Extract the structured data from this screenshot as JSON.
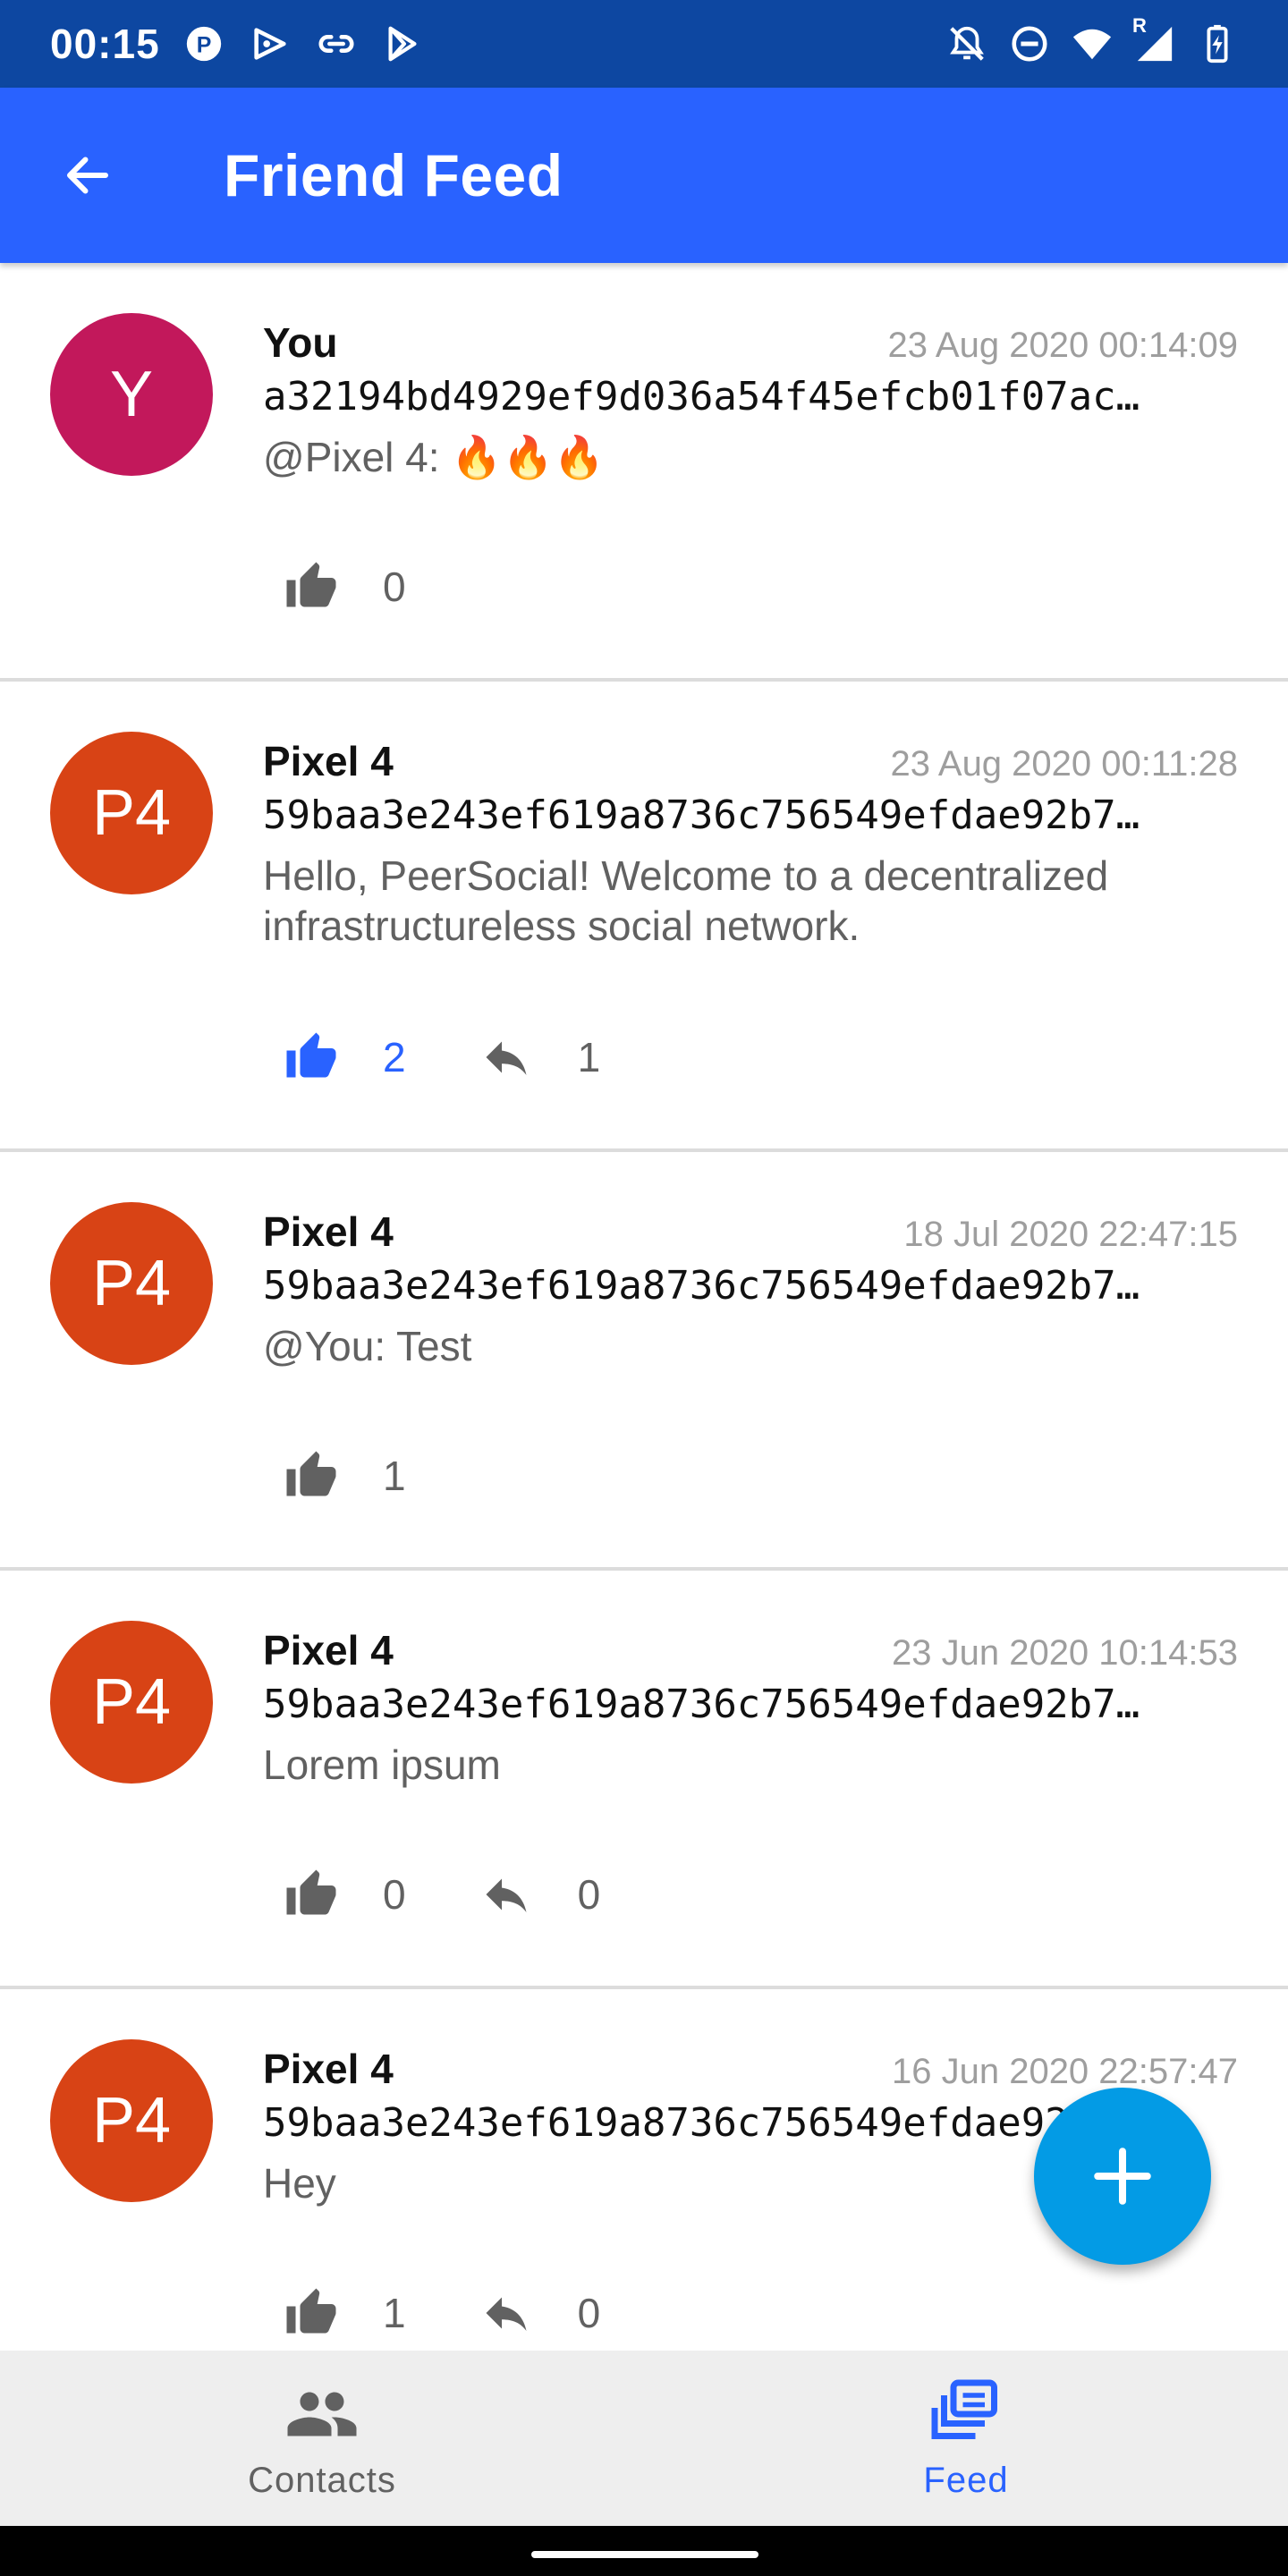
{
  "status_bar": {
    "time": "00:15",
    "left_icons": [
      "app-p-icon",
      "play-games-icon",
      "link-icon",
      "play-store-icon"
    ],
    "right_icons": [
      "mute-icon",
      "dnd-icon",
      "wifi-icon",
      "cell-signal-icon",
      "battery-charging-icon"
    ],
    "roaming_indicator": "R"
  },
  "app_bar": {
    "title": "Friend Feed",
    "back_icon": "arrow-back-icon",
    "color": "#2962ff"
  },
  "posts": [
    {
      "avatar_text": "Y",
      "avatar_color": "#c2185b",
      "author": "You",
      "timestamp": "23 Aug 2020 00:14:09",
      "hash": "a32194bd4929ef9d036a54f45efcb01f07ac…",
      "message": "@Pixel 4: 🔥🔥🔥",
      "likes": "0",
      "liked": false,
      "has_replies": false,
      "replies": ""
    },
    {
      "avatar_text": "P4",
      "avatar_color": "#d84315",
      "author": "Pixel 4",
      "timestamp": "23 Aug 2020 00:11:28",
      "hash": "59baa3e243ef619a8736c756549efdae92b7…",
      "message": "Hello, PeerSocial! Welcome to a decentralized infrastructureless social network.",
      "likes": "2",
      "liked": true,
      "has_replies": true,
      "replies": "1"
    },
    {
      "avatar_text": "P4",
      "avatar_color": "#d84315",
      "author": "Pixel 4",
      "timestamp": "18 Jul 2020 22:47:15",
      "hash": "59baa3e243ef619a8736c756549efdae92b7…",
      "message": "@You: Test",
      "likes": "1",
      "liked": false,
      "has_replies": false,
      "replies": ""
    },
    {
      "avatar_text": "P4",
      "avatar_color": "#d84315",
      "author": "Pixel 4",
      "timestamp": "23 Jun 2020 10:14:53",
      "hash": "59baa3e243ef619a8736c756549efdae92b7…",
      "message": "Lorem ipsum",
      "likes": "0",
      "liked": false,
      "has_replies": true,
      "replies": "0"
    },
    {
      "avatar_text": "P4",
      "avatar_color": "#d84315",
      "author": "Pixel 4",
      "timestamp": "16 Jun 2020 22:57:47",
      "hash": "59baa3e243ef619a8736c756549efdae92b7…",
      "message": "Hey",
      "likes": "1",
      "liked": false,
      "has_replies": true,
      "replies": "0"
    }
  ],
  "fab": {
    "icon": "plus-icon",
    "color": "#039be5"
  },
  "bottom_nav": {
    "items": [
      {
        "label": "Contacts",
        "icon": "contacts-icon",
        "active": false
      },
      {
        "label": "Feed",
        "icon": "feed-icon",
        "active": true
      }
    ],
    "active_color": "#2962ff"
  }
}
